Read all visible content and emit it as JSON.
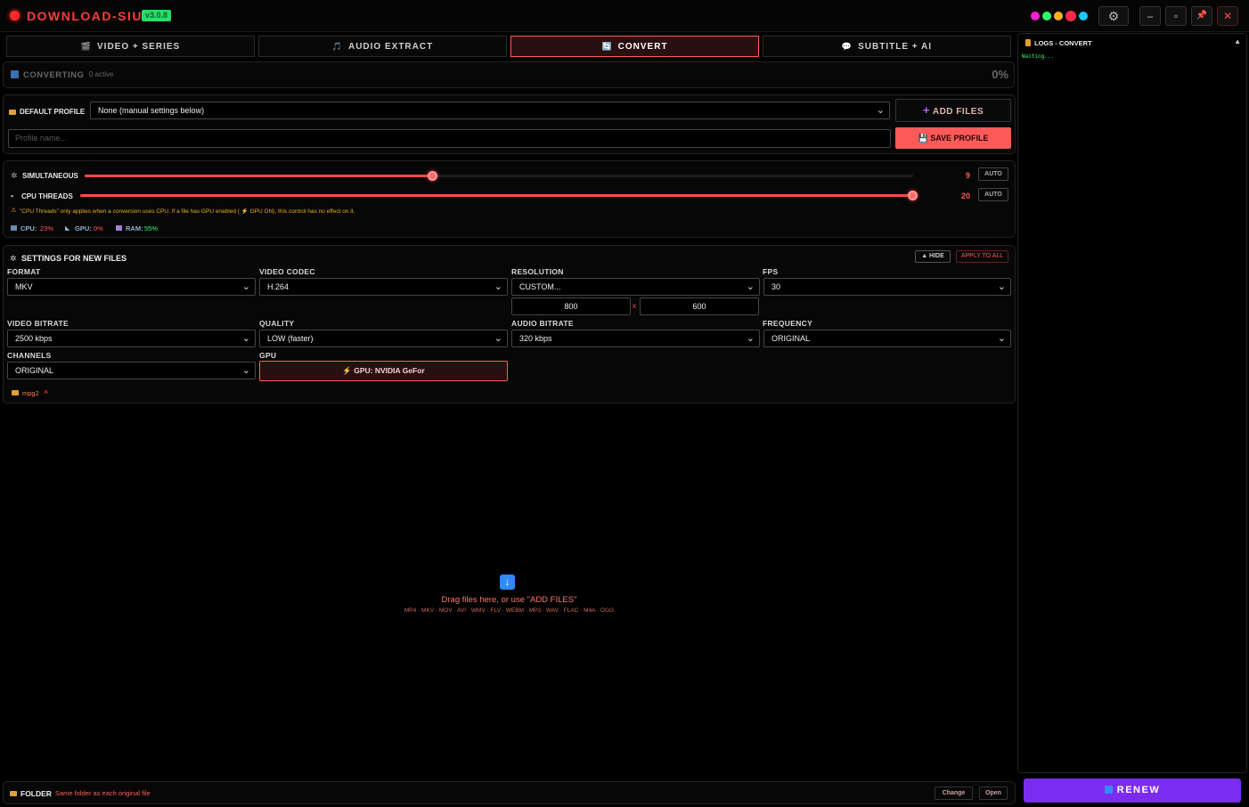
{
  "app": {
    "title": "DOWNLOAD-SIU",
    "version": "v3.0.8"
  },
  "window": {
    "minimize": "–",
    "maximize": "▫",
    "pin": "📌",
    "close": "✕",
    "settings": "⚙"
  },
  "theme_colors": [
    "#ff1fd0",
    "#2dff6a",
    "#ffb020",
    "#ff2a4a",
    "#18c8ff"
  ],
  "tabs": [
    {
      "label": "VIDEO + SERIES",
      "icon": "film-icon",
      "glyph": "🎬"
    },
    {
      "label": "AUDIO EXTRACT",
      "icon": "music-icon",
      "glyph": "🎵"
    },
    {
      "label": "CONVERT",
      "icon": "convert-icon",
      "glyph": "🔄"
    },
    {
      "label": "SUBTITLE + AI",
      "icon": "chat-icon",
      "glyph": "💬"
    }
  ],
  "status": {
    "label": "CONVERTING",
    "active": "0 active",
    "percent": "0%"
  },
  "profile": {
    "label": "DEFAULT PROFILE",
    "selected": "None (manual settings below)",
    "add_files": "ADD FILES",
    "name_placeholder": "Profile name...",
    "save": "SAVE PROFILE"
  },
  "performance": {
    "simultaneous_label": "SIMULTANEOUS",
    "simultaneous_value": "9",
    "simultaneous_fraction": 0.42,
    "threads_label": "CPU THREADS",
    "threads_value": "20",
    "threads_fraction": 1.0,
    "auto": "AUTO",
    "note": "\"CPU Threads\" only applies when a conversion uses CPU. If a file has GPU enabled ( ⚡ GPU ON), this control has no effect on it.",
    "cpu_label": "CPU:",
    "cpu": "23%",
    "gpu_label": "GPU:",
    "gpu": "0%",
    "ram_label": "RAM:",
    "ram": "55%"
  },
  "settings": {
    "title": "SETTINGS FOR NEW FILES",
    "hide": "▲ HIDE",
    "apply_all": "APPLY TO ALL",
    "format_label": "FORMAT",
    "format": "MKV",
    "codec_label": "VIDEO CODEC",
    "codec": "H.264",
    "resolution_label": "RESOLUTION",
    "resolution": "CUSTOM...",
    "width": "800",
    "times": "x",
    "height": "600",
    "fps_label": "FPS",
    "fps": "30",
    "vbitrate_label": "VIDEO BITRATE",
    "vbitrate": "2500 kbps",
    "quality_label": "QUALITY",
    "quality": "LOW (faster)",
    "abitrate_label": "AUDIO BITRATE",
    "abitrate": "320 kbps",
    "frequency_label": "FREQUENCY",
    "frequency": "ORIGINAL",
    "channels_label": "CHANNELS",
    "channels": "ORIGINAL",
    "gpu_label": "GPU",
    "gpu": "GPU: NVIDIA GeFor",
    "tag": "mpg2"
  },
  "drop": {
    "text": "Drag files here, or use \"ADD FILES\"",
    "formats": "MP4 · MKV · MOV · AVI · WMV · FLV · WEBM · MP3 · WAV · FLAC · M4A · OGG"
  },
  "folder": {
    "label": "FOLDER",
    "value": "Same folder as each original file",
    "change": "Change",
    "open": "Open"
  },
  "logs": {
    "title": "LOGS - CONVERT",
    "collapse": "▲",
    "line": "Waiting..."
  },
  "renew": "RENEW"
}
